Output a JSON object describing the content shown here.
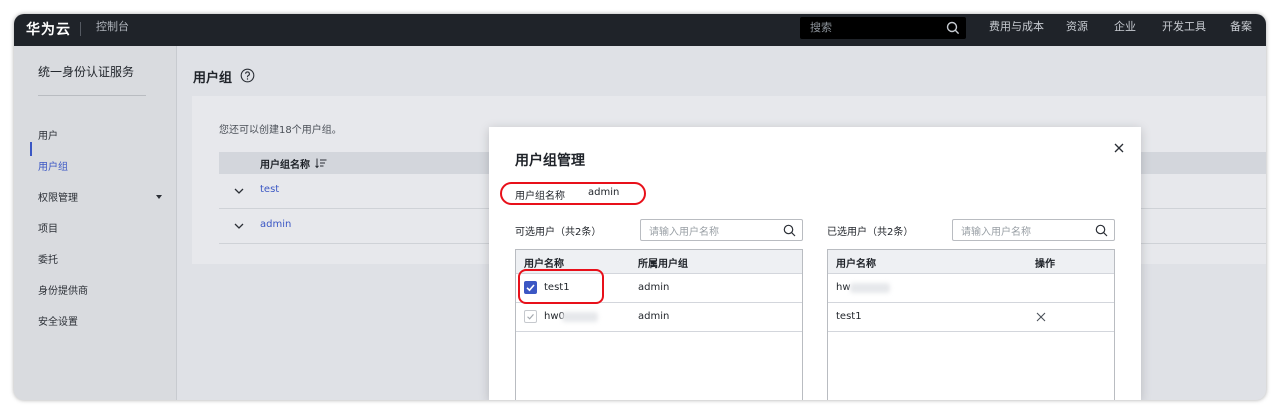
{
  "topbar": {
    "logo": "华为云",
    "console": "控制台",
    "search_placeholder": "搜索",
    "nav": [
      "费用与成本",
      "资源",
      "企业",
      "开发工具",
      "备案"
    ]
  },
  "sidebar": {
    "title": "统一身份认证服务",
    "items": [
      {
        "label": "用户"
      },
      {
        "label": "用户组",
        "active": true
      },
      {
        "label": "权限管理",
        "has_caret": true
      },
      {
        "label": "项目"
      },
      {
        "label": "委托"
      },
      {
        "label": "身份提供商"
      },
      {
        "label": "安全设置"
      }
    ]
  },
  "main": {
    "title": "用户组",
    "hint": "您还可以创建18个用户组。",
    "column": "用户组名称",
    "groups": [
      "test",
      "admin"
    ]
  },
  "modal": {
    "title": "用户组管理",
    "group_name_label": "用户组名称",
    "group_name_value": "admin",
    "available": {
      "label": "可选用户（共2条）",
      "search_placeholder": "请输入用户名称",
      "headers": [
        "用户名称",
        "所属用户组"
      ],
      "rows": [
        {
          "name": "test1",
          "group": "admin",
          "checked": true
        },
        {
          "name": "hw0",
          "group": "admin",
          "checked": false
        }
      ]
    },
    "selected": {
      "label": "已选用户（共2条）",
      "search_placeholder": "请输入用户名称",
      "headers": [
        "用户名称",
        "操作"
      ],
      "rows": [
        {
          "name": "hw"
        },
        {
          "name": "test1",
          "removable": true
        }
      ]
    }
  },
  "colors": {
    "accent": "#3b57c4",
    "highlight": "#e8101a",
    "topbar": "#1f2329"
  }
}
